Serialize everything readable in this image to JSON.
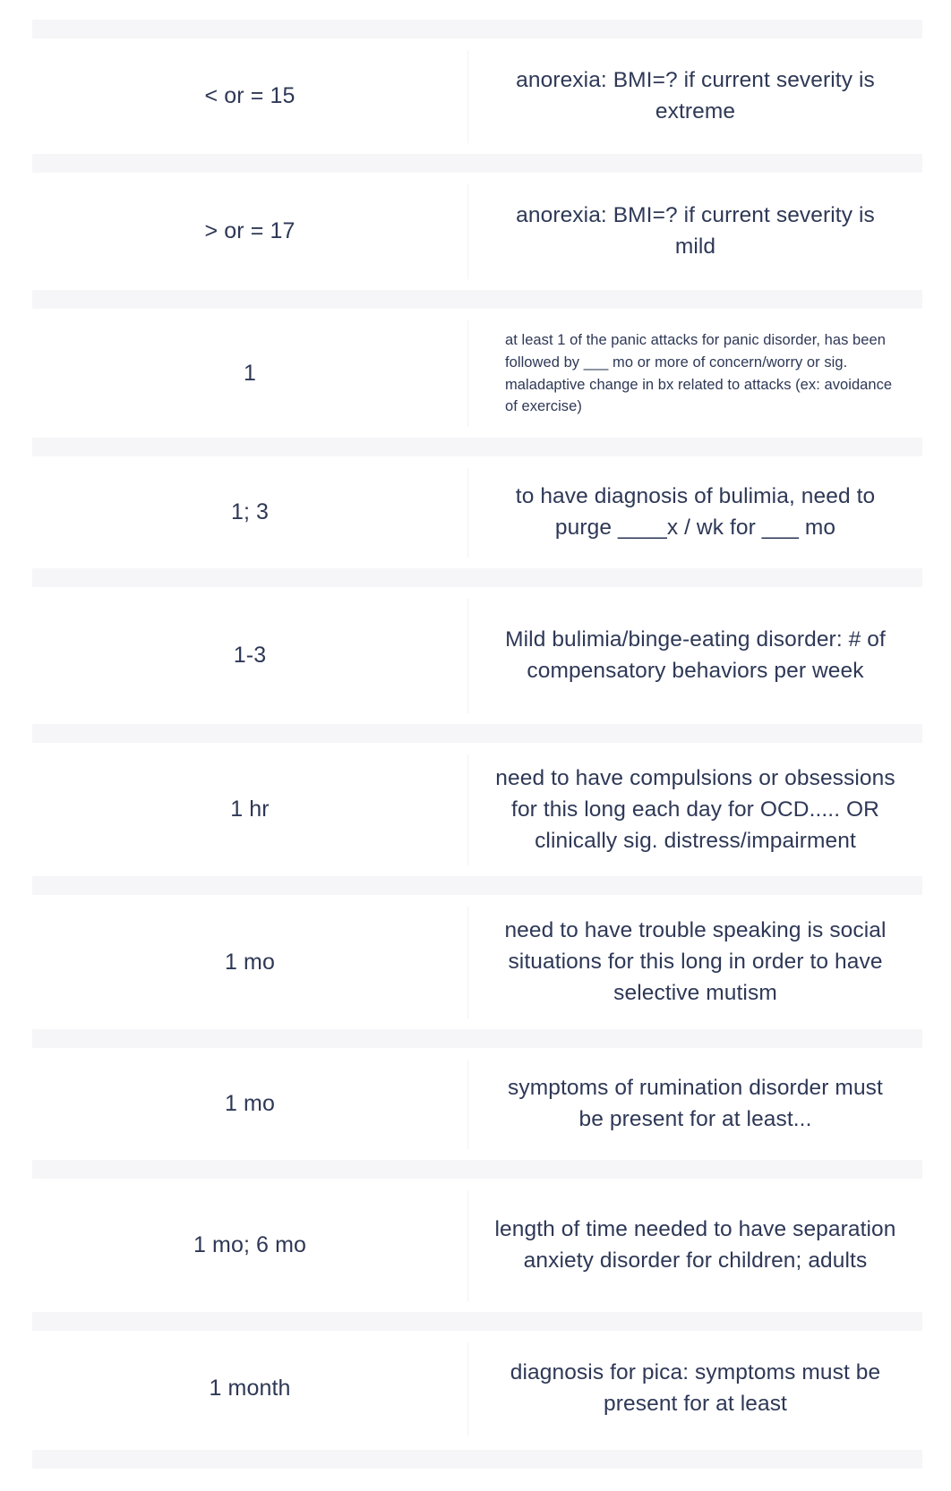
{
  "page": {
    "kind": "flashcard-term-definition-list",
    "columns": [
      "term",
      "definition"
    ],
    "text_color": "#2e3856",
    "background_color": "#ffffff",
    "separator_color": "#f4f5f7"
  },
  "rows": [
    {
      "term": "< or = 15",
      "definition": "anorexia: BMI=? if current severity is extreme",
      "style": "large"
    },
    {
      "term": "> or = 17",
      "definition": "anorexia: BMI=? if current severity is mild",
      "style": "large"
    },
    {
      "term": "1",
      "definition": "at least 1 of the panic attacks for panic disorder, has been followed by ___ mo or more of concern/worry or sig. maladaptive change in bx related to attacks (ex: avoidance of exercise)",
      "style": "small"
    },
    {
      "term": "1; 3",
      "definition": "to have diagnosis of bulimia, need to purge ____x / wk for ___ mo",
      "style": "large"
    },
    {
      "term": "1-3",
      "definition": "Mild bulimia/binge-eating disorder: # of compensatory behaviors per week",
      "style": "large"
    },
    {
      "term": "1 hr",
      "definition": "need to have compulsions or obsessions for this long each day for OCD..... OR clinically sig. distress/impairment",
      "style": "large"
    },
    {
      "term": "1 mo",
      "definition": "need to have trouble speaking is social situations for this long in order to have selective mutism",
      "style": "large"
    },
    {
      "term": "1 mo",
      "definition": "symptoms of rumination disorder must be present for at least...",
      "style": "large"
    },
    {
      "term": "1 mo; 6 mo",
      "definition": "length of time needed to have separation anxiety disorder for children; adults",
      "style": "large"
    },
    {
      "term": "1 month",
      "definition": "diagnosis for pica: symptoms must be present for at least",
      "style": "large"
    }
  ]
}
